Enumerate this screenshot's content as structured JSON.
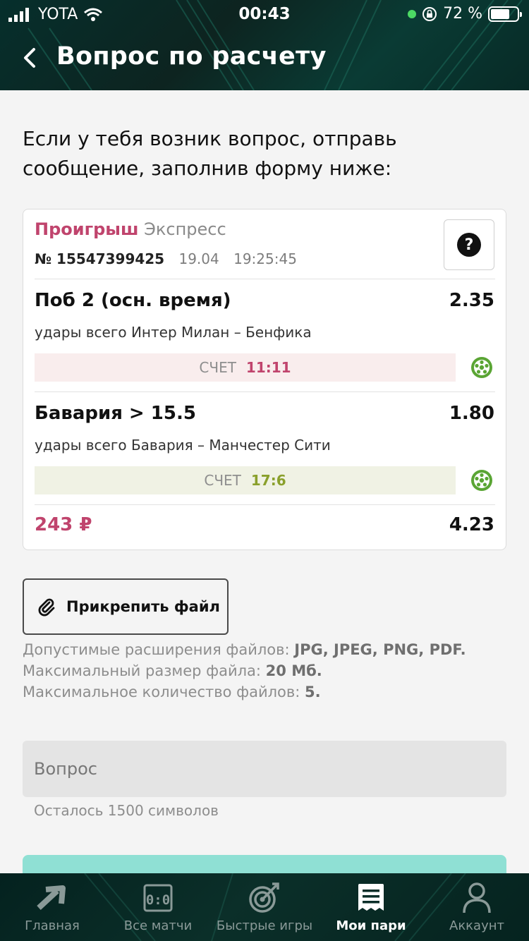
{
  "status_bar": {
    "carrier": "YOTA",
    "time": "00:43",
    "battery_percent": "72 %",
    "battery_level": 0.72
  },
  "header": {
    "title": "Вопрос по расчету"
  },
  "intro_text": "Если у тебя возник вопрос, отправь сообщение, заполнив форму ниже:",
  "bet_card": {
    "status": "Проигрыш",
    "type": "Экспресс",
    "ticket_number": "№ 15547399425",
    "date": "19.04",
    "time": "19:25:45",
    "help_label": "?",
    "bets": [
      {
        "title": "Поб 2 (осн. время)",
        "odds": "2.35",
        "event": "удары всего Интер Милан – Бенфика",
        "score_label": "СЧЕТ",
        "score": "11:11",
        "result": "lost"
      },
      {
        "title": "Бавария > 15.5",
        "odds": "1.80",
        "event": "удары всего Бавария – Манчестер Сити",
        "score_label": "СЧЕТ",
        "score": "17:6",
        "result": "won"
      }
    ],
    "amount": "243 ₽",
    "total_odds": "4.23"
  },
  "attach": {
    "label": "Прикрепить файл",
    "info_line1_prefix": "Допустимые расширения файлов: ",
    "info_line1_value": "JPG, JPEG, PNG, PDF.",
    "info_line2_prefix": "Максимальный размер файла: ",
    "info_line2_value": "20 Мб.",
    "info_line3_prefix": "Максимальное количество файлов: ",
    "info_line3_value": "5."
  },
  "question": {
    "placeholder": "Вопрос",
    "chars_left": "Осталось 1500 символов"
  },
  "tabbar": {
    "items": [
      {
        "label": "Главная",
        "icon": "arrow-icon",
        "active": false
      },
      {
        "label": "Все матчи",
        "icon": "scoreboard-icon",
        "active": false
      },
      {
        "label": "Быстрые игры",
        "icon": "target-icon",
        "active": false
      },
      {
        "label": "Мои пари",
        "icon": "receipt-icon",
        "active": true
      },
      {
        "label": "Аккаунт",
        "icon": "user-icon",
        "active": false
      }
    ]
  },
  "colors": {
    "lost": "#c0446d",
    "won": "#8aa02c",
    "accent_submit": "#8fe0d4",
    "header_bg": "#0a2b27"
  }
}
